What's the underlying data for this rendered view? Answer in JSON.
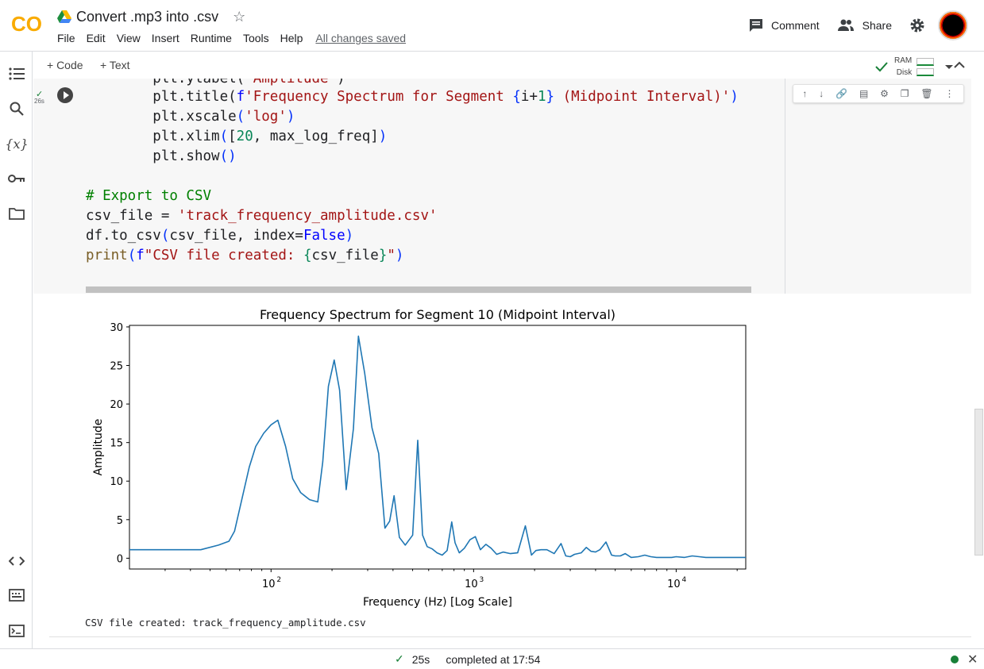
{
  "app": {
    "logo_text": "CO",
    "doc_title": "Convert .mp3 into .csv",
    "menu": [
      "File",
      "Edit",
      "View",
      "Insert",
      "Runtime",
      "Tools",
      "Help"
    ],
    "saved_status": "All changes saved",
    "comment_label": "Comment",
    "share_label": "Share"
  },
  "toolbar": {
    "add_code": "+ Code",
    "add_text": "+ Text",
    "ram_label": "RAM",
    "disk_label": "Disk"
  },
  "cell": {
    "exec_time": "26s",
    "code_lines": [
      "        plt.ylabel('Amplitude')",
      "        plt.title(f'Frequency Spectrum for Segment {i+1} (Midpoint Interval)')",
      "        plt.xscale('log')",
      "        plt.xlim([20, max_log_freq])",
      "        plt.show()",
      "",
      "# Export to CSV",
      "csv_file = 'track_frequency_amplitude.csv'",
      "df.to_csv(csv_file, index=False)",
      "print(f\"CSV file created: {csv_file}\")"
    ]
  },
  "output": {
    "text": "CSV file created: track_frequency_amplitude.csv"
  },
  "status": {
    "duration": "25s",
    "completed": "completed at 17:54"
  },
  "chart_data": {
    "type": "line",
    "title": "Frequency Spectrum for Segment 10 (Midpoint Interval)",
    "xlabel": "Frequency (Hz) [Log Scale]",
    "ylabel": "Amplitude",
    "xscale": "log",
    "xlim": [
      20,
      22050
    ],
    "ylim": [
      -1.4,
      30.2
    ],
    "yticks": [
      0,
      5,
      10,
      15,
      20,
      25,
      30
    ],
    "xticks": [
      {
        "value": 100,
        "label": "10",
        "exp": "2"
      },
      {
        "value": 1000,
        "label": "10",
        "exp": "3"
      },
      {
        "value": 10000,
        "label": "10",
        "exp": "4"
      }
    ],
    "color": "#1f77b4",
    "series": [
      {
        "x": [
          20,
          30,
          45,
          55,
          62,
          66,
          72,
          78,
          84,
          92,
          100,
          108,
          118,
          128,
          140,
          155,
          170,
          180,
          192,
          205,
          218,
          235,
          255,
          270,
          290,
          315,
          340,
          365,
          385,
          405,
          430,
          460,
          500,
          530,
          560,
          590,
          625,
          660,
          700,
          740,
          780,
          810,
          850,
          900,
          960,
          1020,
          1080,
          1150,
          1220,
          1300,
          1400,
          1520,
          1650,
          1800,
          1930,
          2030,
          2150,
          2300,
          2500,
          2700,
          2850,
          3000,
          3150,
          3400,
          3600,
          3800,
          4000,
          4200,
          4500,
          4800,
          5000,
          5300,
          5600,
          6000,
          6500,
          7000,
          7500,
          8000,
          8500,
          9000,
          9500,
          10000,
          11000,
          12000,
          13000,
          14000,
          15000,
          16000,
          17000,
          18000,
          20000,
          22050
        ],
        "y": [
          1.1,
          1.1,
          1.1,
          1.7,
          2.2,
          3.5,
          7.8,
          11.8,
          14.5,
          16.2,
          17.3,
          17.9,
          14.5,
          10.3,
          8.5,
          7.6,
          7.3,
          12.5,
          22.3,
          25.7,
          21.8,
          8.9,
          16.8,
          28.8,
          24.0,
          16.9,
          13.6,
          3.9,
          4.8,
          8.1,
          2.7,
          1.7,
          3.0,
          15.3,
          3.0,
          1.5,
          1.2,
          0.7,
          0.4,
          1.0,
          4.7,
          2.0,
          0.7,
          1.3,
          2.4,
          2.8,
          1.1,
          1.8,
          1.3,
          0.5,
          0.8,
          0.6,
          0.7,
          4.2,
          0.4,
          1.0,
          1.1,
          1.1,
          0.6,
          1.9,
          0.3,
          0.2,
          0.5,
          0.7,
          1.4,
          0.9,
          0.8,
          1.1,
          2.1,
          0.4,
          0.3,
          0.3,
          0.6,
          0.1,
          0.2,
          0.4,
          0.2,
          0.1,
          0.1,
          0.1,
          0.1,
          0.2,
          0.1,
          0.3,
          0.2,
          0.1,
          0.1,
          0.1,
          0.1,
          0.1,
          0.1,
          0.1
        ]
      }
    ]
  }
}
